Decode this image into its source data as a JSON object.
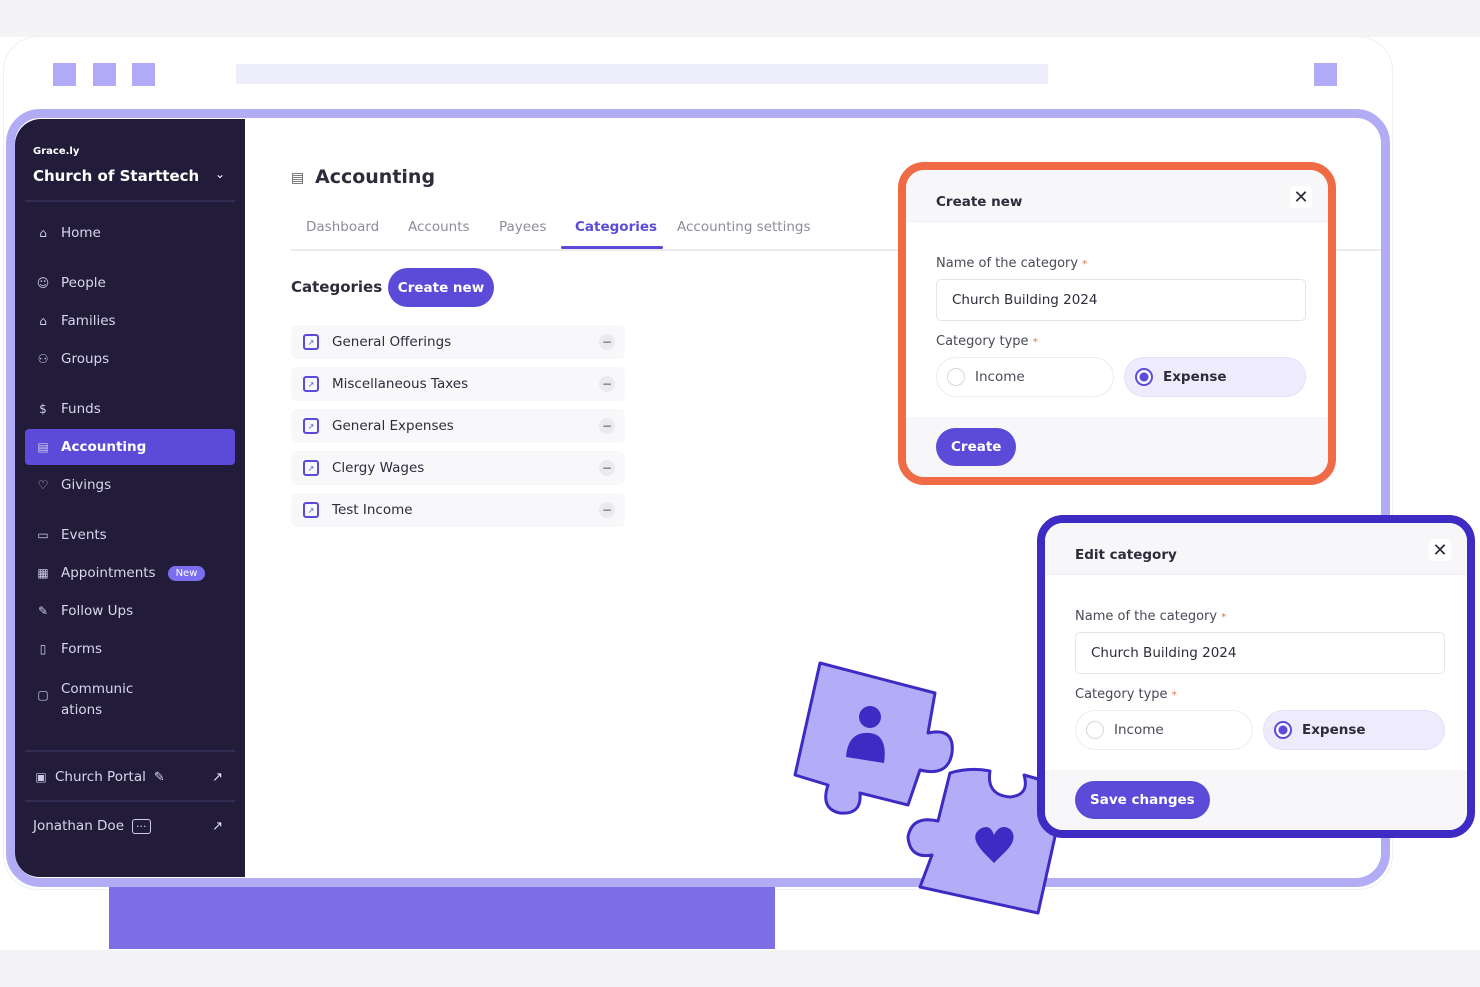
{
  "sidebar": {
    "brand": "Grace.ly",
    "org_name": "Church of Starttech",
    "items": [
      {
        "label": "Home",
        "icon": "home-icon"
      },
      {
        "label": "People",
        "icon": "people-icon"
      },
      {
        "label": "Families",
        "icon": "families-icon"
      },
      {
        "label": "Groups",
        "icon": "groups-icon"
      },
      {
        "label": "Funds",
        "icon": "funds-icon"
      },
      {
        "label": "Accounting",
        "icon": "accounting-icon",
        "active": true
      },
      {
        "label": "Givings",
        "icon": "heart-icon"
      },
      {
        "label": "Events",
        "icon": "calendar-icon"
      },
      {
        "label": "Appointments",
        "icon": "appointments-icon",
        "badge": "New"
      },
      {
        "label": "Follow Ups",
        "icon": "followups-icon"
      },
      {
        "label": "Forms",
        "icon": "forms-icon"
      },
      {
        "label": "Communic\nations",
        "icon": "chat-icon"
      }
    ],
    "portal_label": "Church Portal",
    "user_name": "Jonathan Doe"
  },
  "header": {
    "title": "Accounting"
  },
  "tabs": [
    {
      "label": "Dashboard"
    },
    {
      "label": "Accounts"
    },
    {
      "label": "Payees"
    },
    {
      "label": "Categories",
      "active": true
    },
    {
      "label": "Accounting settings"
    }
  ],
  "categories": {
    "section_title": "Categories",
    "create_label": "Create new",
    "items": [
      {
        "name": "General Offerings"
      },
      {
        "name": "Miscellaneous Taxes"
      },
      {
        "name": "General Expenses"
      },
      {
        "name": "Clergy Wages"
      },
      {
        "name": "Test Income"
      }
    ]
  },
  "create_modal": {
    "title": "Create new",
    "name_label": "Name of the category",
    "name_value": "Church Building 2024",
    "type_label": "Category type",
    "option_income": "Income",
    "option_expense": "Expense",
    "selected": "Expense",
    "submit_label": "Create"
  },
  "edit_modal": {
    "title": "Edit category",
    "name_label": "Name of the category",
    "name_value": "Church Building 2024",
    "type_label": "Category type",
    "option_income": "Income",
    "option_expense": "Expense",
    "selected": "Expense",
    "submit_label": "Save changes"
  },
  "colors": {
    "accent": "#5b4bd8",
    "sidebar_bg": "#221c3a",
    "create_border": "#ef6b45",
    "edit_border": "#3d2bc4",
    "frame": "#b2acf4"
  }
}
